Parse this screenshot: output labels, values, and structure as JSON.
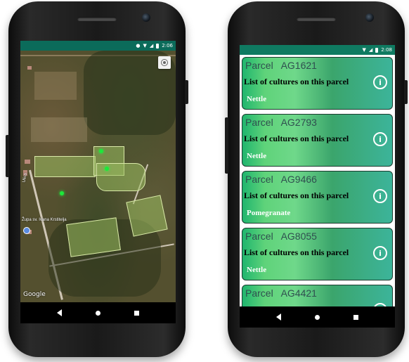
{
  "left_phone": {
    "status_time": "2:06",
    "map": {
      "place_label": "Župa sv. Ivana Krstitelja",
      "road_label": "Ulica",
      "attribution": "Google"
    },
    "icons": {
      "locate": "my-location-icon",
      "back": "back-triangle-icon",
      "home": "home-circle-icon",
      "recent": "recent-square-icon"
    }
  },
  "right_phone": {
    "status_time": "2:08",
    "subtitle": "List of cultures on this parcel",
    "parcels": [
      {
        "title": "Parcel   AG1621",
        "culture": "Nettle"
      },
      {
        "title": "Parcel   AG2793",
        "culture": "Nettle"
      },
      {
        "title": "Parcel   AG9466",
        "culture": "Pomegranate"
      },
      {
        "title": "Parcel   AG8055",
        "culture": "Nettle"
      },
      {
        "title": "Parcel   AG4421",
        "culture": ""
      }
    ],
    "icons": {
      "info": "info-icon"
    }
  },
  "colors": {
    "status_bar": "#0b6b5a",
    "card_gradient_start": "#1fb56e",
    "card_gradient_end": "#3cb49a",
    "map_marker": "#1de83a"
  }
}
